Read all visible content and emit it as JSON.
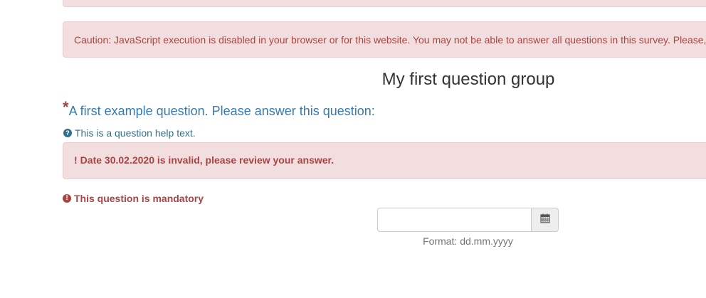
{
  "alerts": {
    "javascript_warning": "Caution: JavaScript execution is disabled in your browser or for this website. You may not be able to answer all questions in this survey. Please, v",
    "date_error_mark": "!",
    "date_error": "Date 30.02.2020 is invalid, please review your answer."
  },
  "group": {
    "title": "My first question group"
  },
  "question": {
    "mandatory_mark": "*",
    "text": "A first example question. Please answer this question:",
    "help_icon_glyph": "?",
    "help_text": "This is a question help text.",
    "mandatory_icon_glyph": "!",
    "mandatory_text": "This question is mandatory"
  },
  "date_field": {
    "value": "",
    "placeholder": "",
    "calendar_icon": "calendar-icon",
    "format_hint": "Format: dd.mm.yyyy"
  },
  "colors": {
    "alert_bg": "#f2dede",
    "alert_border": "#ebccd1",
    "alert_text": "#a94442",
    "question_text": "#337ab7",
    "help_text": "#31708f"
  }
}
